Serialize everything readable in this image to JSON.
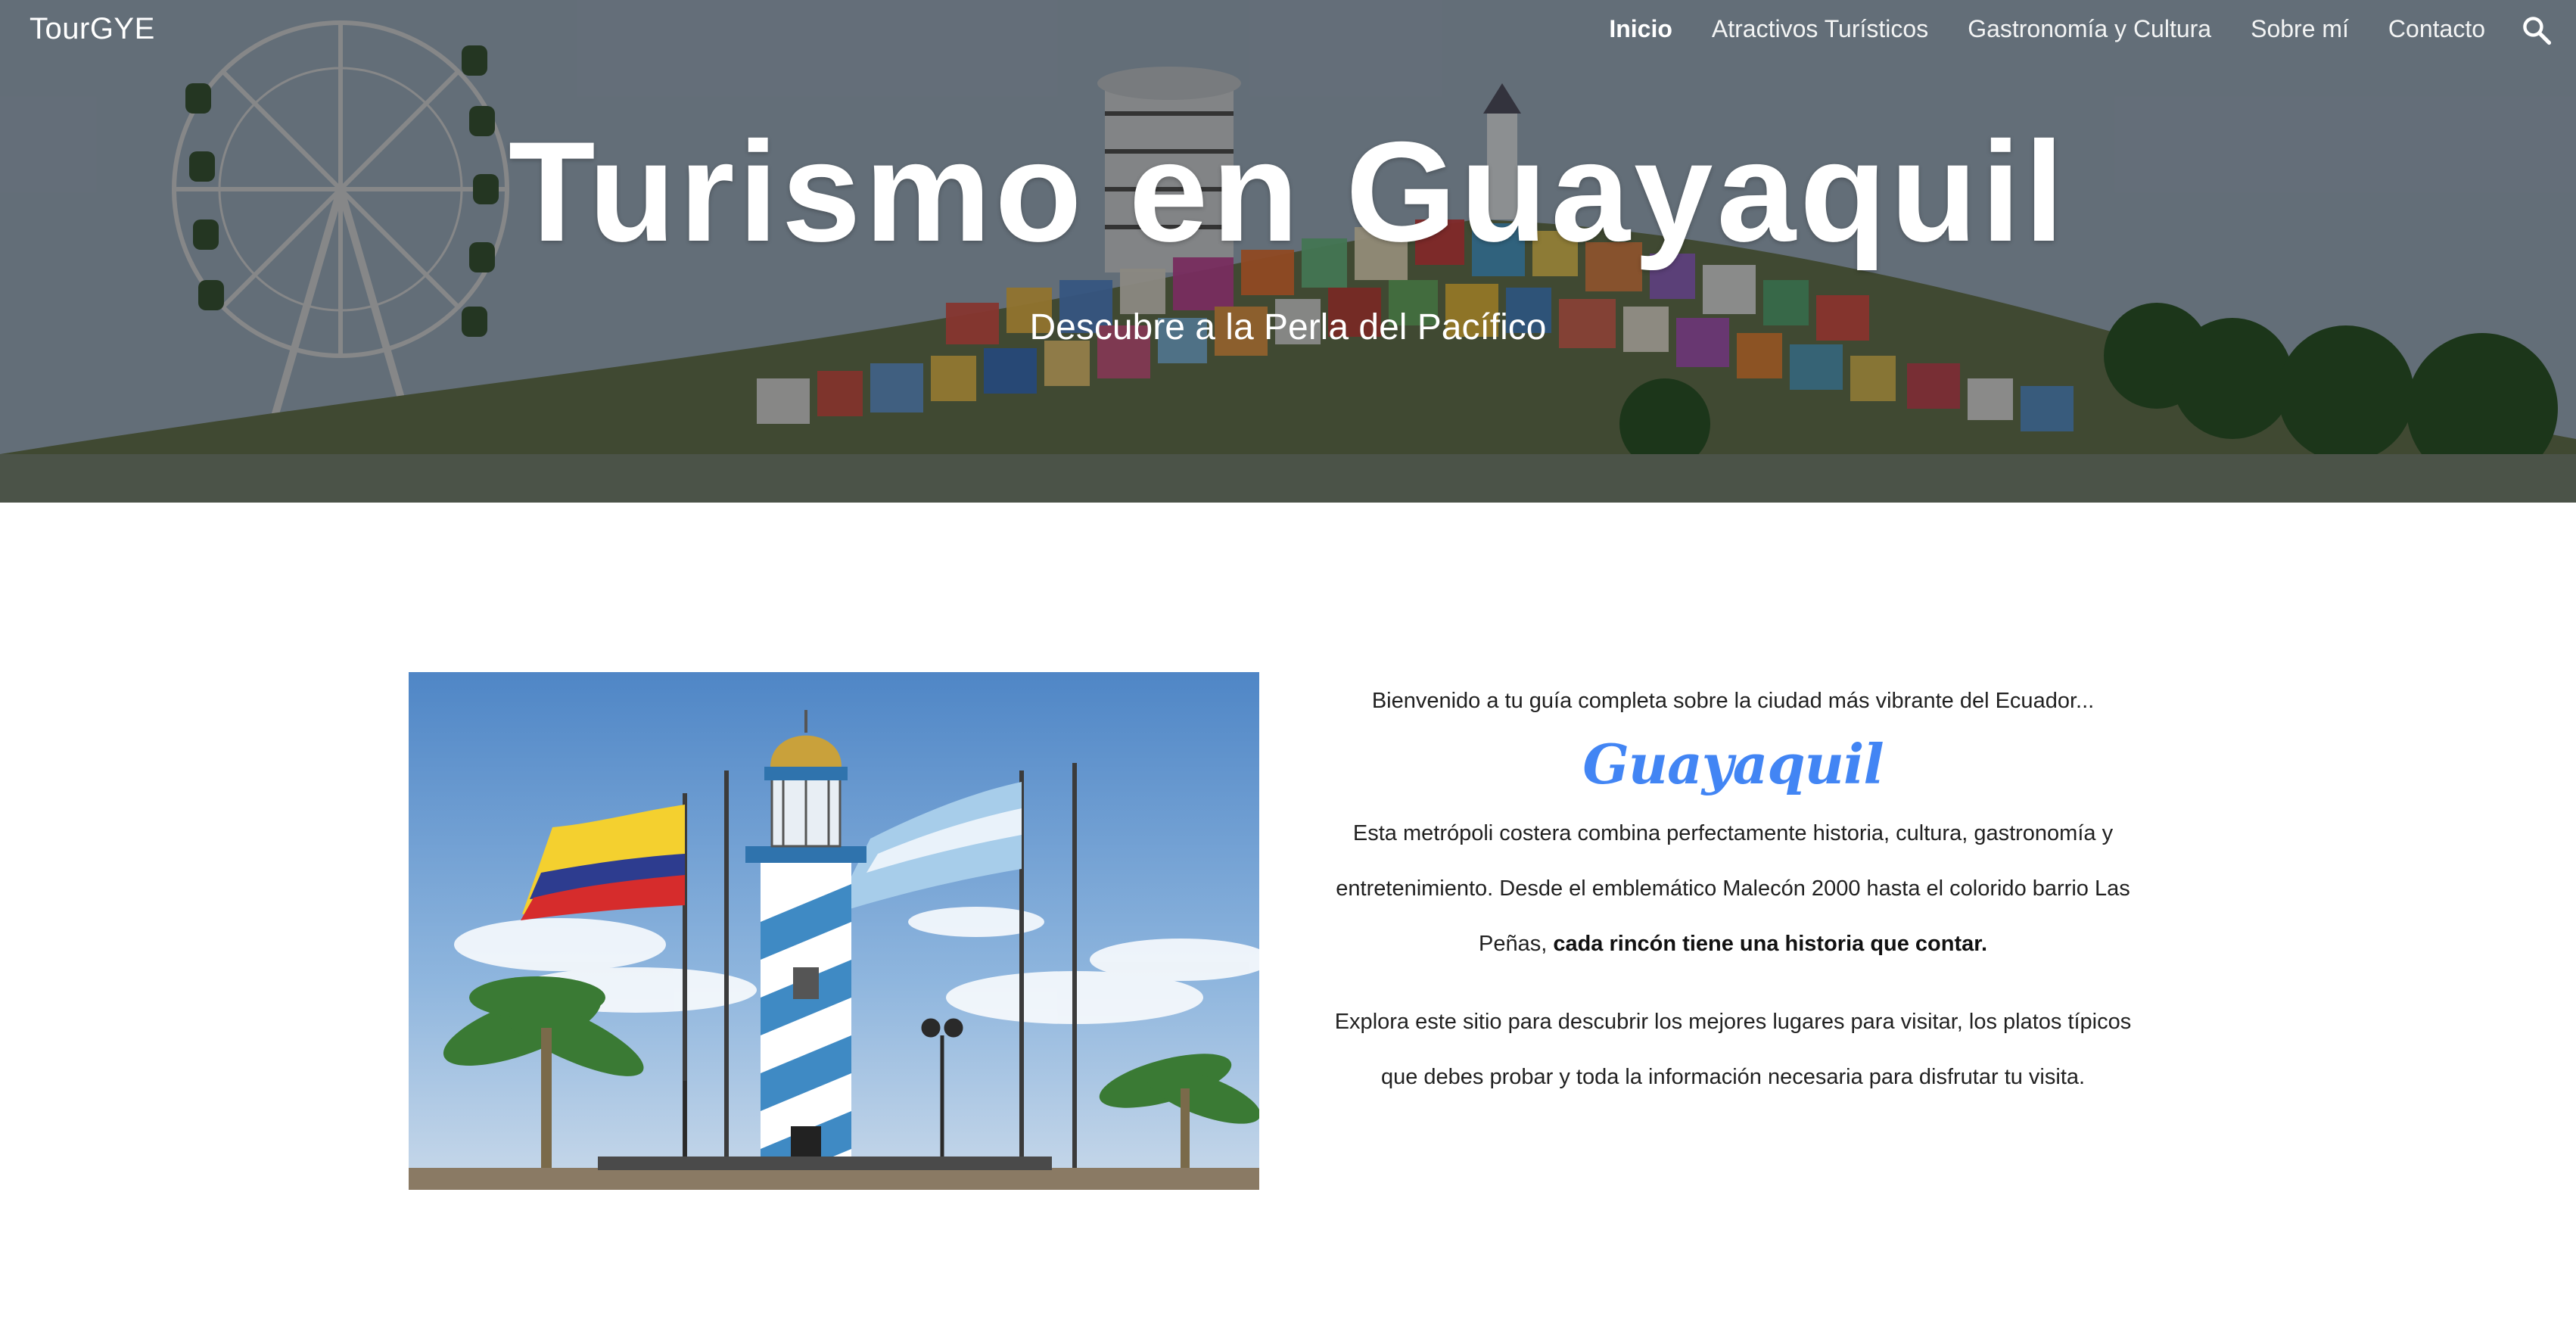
{
  "nav": {
    "brand": "TourGYE",
    "links": [
      {
        "label": "Inicio",
        "active": true
      },
      {
        "label": "Atractivos Turísticos",
        "active": false
      },
      {
        "label": "Gastronomía y Cultura",
        "active": false
      },
      {
        "label": "Sobre mí",
        "active": false
      },
      {
        "label": "Contacto",
        "active": false
      }
    ],
    "search_icon": "search-icon"
  },
  "hero": {
    "title": "Turismo en Guayaquil",
    "subtitle": "Descubre a la Perla del Pacífico"
  },
  "content": {
    "intro": "Bienvenido a tu guía completa sobre la ciudad más vibrante  del Ecuador...",
    "city_name": "Guayaquil",
    "paragraph1_start": "Esta metrópoli costera combina perfectamente historia, cultura, gastronomía y entretenimiento. Desde el emblemático Malecón 2000 hasta el colorido barrio Las Peñas, ",
    "paragraph1_bold": "cada rincón tiene una historia que contar.",
    "paragraph2": "Explora  este sitio para descubrir los mejores lugares para visitar, los platos típicos que debes probar y toda la información necesaria para disfrutar tu visita."
  },
  "colors": {
    "accent": "#4285f4",
    "text": "#212121",
    "hero_overlay": "rgba(0,0,0,0.40)"
  }
}
